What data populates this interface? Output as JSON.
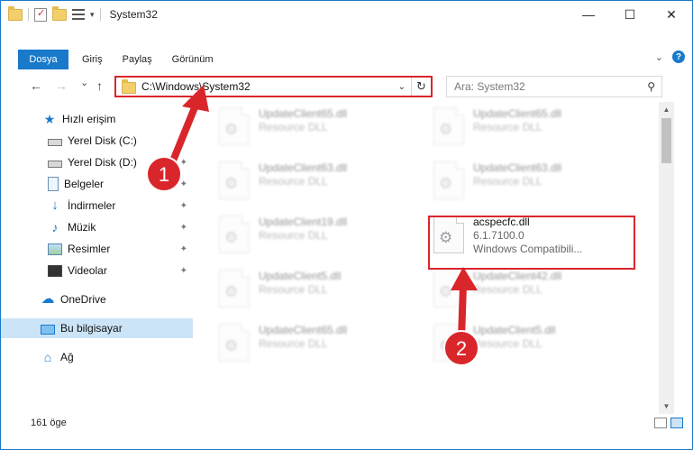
{
  "window": {
    "title": "System32",
    "controls": {
      "minimize": "—",
      "maximize": "☐",
      "close": "✕"
    }
  },
  "ribbon": {
    "tabs": [
      "Dosya",
      "Giriş",
      "Paylaş",
      "Görünüm"
    ],
    "expand_icon": "chevron-down-icon",
    "help_label": "?"
  },
  "nav": {
    "back": "←",
    "forward": "→",
    "recent": "⌄",
    "up": "↑"
  },
  "address": {
    "path": "C:\\Windows\\System32",
    "dropdown": "⌄",
    "refresh": "↻"
  },
  "search": {
    "placeholder": "Ara: System32",
    "icon": "⚲"
  },
  "sidebar": {
    "items": [
      {
        "label": "Hızlı erişim",
        "icon": "star-icon",
        "pinned": false
      },
      {
        "label": "Yerel Disk (C:)",
        "icon": "drive-icon",
        "pinned": false
      },
      {
        "label": "Yerel Disk (D:)",
        "icon": "drive-icon",
        "pinned": true
      },
      {
        "label": "Belgeler",
        "icon": "documents-icon",
        "pinned": true
      },
      {
        "label": "İndirmeler",
        "icon": "download-icon",
        "pinned": true
      },
      {
        "label": "Müzik",
        "icon": "music-icon",
        "pinned": true
      },
      {
        "label": "Resimler",
        "icon": "pictures-icon",
        "pinned": true
      },
      {
        "label": "Videolar",
        "icon": "videos-icon",
        "pinned": true
      },
      {
        "label": "OneDrive",
        "icon": "onedrive-icon",
        "pinned": false
      },
      {
        "label": "Bu bilgisayar",
        "icon": "this-pc-icon",
        "pinned": false,
        "selected": true
      },
      {
        "label": "Ağ",
        "icon": "network-icon",
        "pinned": false
      }
    ],
    "pin_glyph": "📌"
  },
  "files": [
    {
      "name": "UpdateClient65.dll",
      "sub": "Resource DLL"
    },
    {
      "name": "UpdateClient65.dll",
      "sub": "Resource DLL"
    },
    {
      "name": "UpdateClient63.dll",
      "sub": "Resource DLL"
    },
    {
      "name": "UpdateClient63.dll",
      "sub": "Resource DLL"
    },
    {
      "name": "UpdateClient19.dll",
      "sub": "Resource DLL"
    },
    {
      "name": "acspecfc.dll",
      "sub": "6.1.7100.0",
      "sub2": "Windows Compatibili..."
    },
    {
      "name": "UpdateClient5.dll",
      "sub": "Resource DLL"
    },
    {
      "name": "UpdateClient42.dll",
      "sub": "Resource DLL"
    },
    {
      "name": "UpdateClient65.dll",
      "sub": "Resource DLL"
    },
    {
      "name": "UpdateClient5.dll",
      "sub": "Resource DLL"
    }
  ],
  "status": {
    "count": "161 öge"
  },
  "annotations": {
    "step1": "1",
    "step2": "2",
    "color": "#d9262b"
  }
}
